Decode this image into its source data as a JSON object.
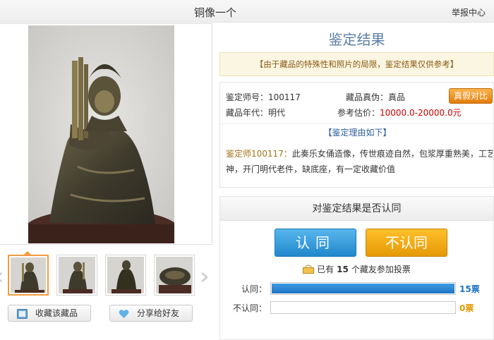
{
  "header": {
    "title": "铜像一个",
    "report_label": "举报中心"
  },
  "gallery": {
    "thumbnail_count": 4,
    "active_index": 0
  },
  "actions": {
    "collect_label": "收藏该藏品",
    "share_label": "分享给好友"
  },
  "result": {
    "title": "鉴定结果",
    "notice": "【由于藏品的特殊性和照片的局限，鉴定结果仅供参考】",
    "appraiser_label": "鉴定师号：",
    "appraiser_id": "100117",
    "authenticity_label": "藏品真伪：",
    "authenticity": "真品",
    "compare_button": "真假对比",
    "era_label": "藏品年代：",
    "era": "明代",
    "estimate_label": "参考估价：",
    "estimate": "10000.0-20000.0元",
    "reason_heading": "【鉴定理由如下】",
    "reason_author": "鉴定师100117：",
    "reason_line1": "此奏乐女俑造像，传世痕迹自然，包浆厚重熟美，工艺传",
    "reason_line2": "神，开门明代老件，缺底座，有一定收藏价值"
  },
  "vote": {
    "heading": "对鉴定结果是否认同",
    "agree_button": "认同",
    "disagree_button": "不认同",
    "count_prefix": "已有",
    "count": "15",
    "count_suffix": "个藏友参加投票",
    "agree_label": "认同：",
    "agree_count": "15票",
    "agree_fraction": 1.0,
    "disagree_label": "不认同：",
    "disagree_count": "0票",
    "disagree_fraction": 0.0
  },
  "colors": {
    "agree_blue": "#2188cc",
    "disagree_gold": "#e49a06",
    "title_blue": "#5b7fa6",
    "price_red": "#cc0000",
    "agree_count_color": "#1f73c4",
    "disagree_count_color": "#e49a06"
  },
  "icons": [
    "collect-icon",
    "heart-icon",
    "lock-icon",
    "chevron-left-icon",
    "chevron-right-icon"
  ]
}
